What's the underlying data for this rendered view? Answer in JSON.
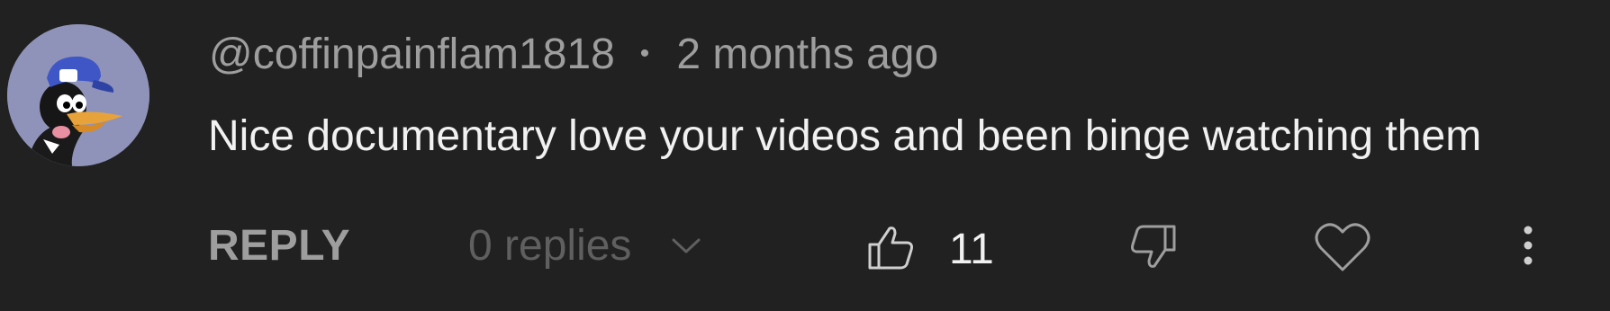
{
  "comment": {
    "author": "@coffinpainflam1818",
    "separator": "•",
    "timestamp": "2 months ago",
    "text": "Nice documentary love your videos and been binge watching them",
    "reply_label": "REPLY",
    "replies_label": "0 replies",
    "like_count": "11"
  },
  "icons": {
    "avatar": "daffy-duck-avatar",
    "like": "thumbs-up-icon",
    "dislike": "thumbs-down-icon",
    "heart": "heart-icon",
    "expand": "chevron-down-icon",
    "more": "more-vertical-icon"
  },
  "colors": {
    "background": "#212121",
    "primary_text": "#f1f1f1",
    "secondary_text": "#9e9e9e",
    "muted_text": "#5f5f5f",
    "avatar_bg": "#8f93b9"
  }
}
